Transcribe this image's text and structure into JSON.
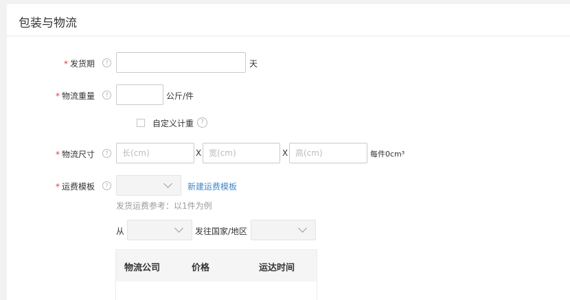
{
  "section": {
    "title": "包装与物流"
  },
  "lead_time": {
    "label": "发货期",
    "value": "",
    "unit": "天"
  },
  "weight": {
    "label": "物流重量",
    "value": "",
    "unit": "公斤/件",
    "custom_label": "自定义计重"
  },
  "dimensions": {
    "label": "物流尺寸",
    "length_placeholder": "长(cm)",
    "width_placeholder": "宽(cm)",
    "height_placeholder": "高(cm)",
    "separator": "X",
    "volume_text": "每件0cm³"
  },
  "shipping_template": {
    "label": "运费模板",
    "selected": "",
    "new_link": "新建运费模板",
    "reference_note": "发货运费参考：以1件为例",
    "from_label": "从",
    "destination_label": "发往国家/地区"
  },
  "shipping_table": {
    "columns": [
      "物流公司",
      "价格",
      "运达时间"
    ]
  },
  "help_icon_glyph": "?",
  "colors": {
    "required": "#e4393c",
    "link": "#3f87c9"
  }
}
